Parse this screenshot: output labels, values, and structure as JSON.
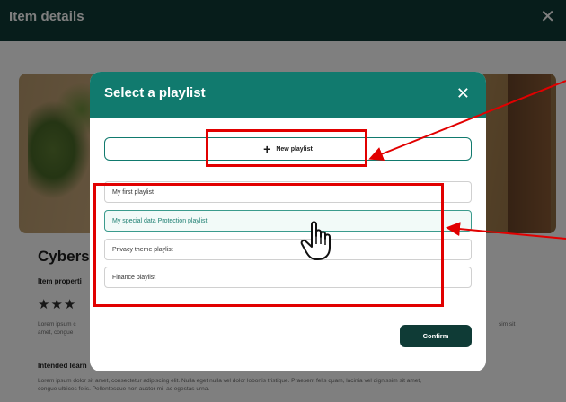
{
  "background": {
    "header_title": "Item details",
    "close_glyph": "✕",
    "heading": "Cybers",
    "properties_label": "Item properti",
    "stars": "★★★",
    "paragraph_left": [
      "Lorem ipsum c",
      "amet, congue"
    ],
    "paragraph_right": "sim sit",
    "intended_label": "Intended learn",
    "footer_text": [
      "Lorem ipsum dolor sit amet, consectetur adipiscing elit. Nulla eget nulla vel dolor lobortis tristique. Praesent felis quam, lacinia vel dignissim sit amet,",
      "congue ultrices felis. Pellentesque non auctor mi, ac egestas urna."
    ]
  },
  "modal": {
    "title": "Select a playlist",
    "close_glyph": "✕",
    "new_playlist_icon": "plus-icon",
    "new_playlist_label": "New playlist",
    "playlists": [
      {
        "label": "My first playlist",
        "selected": false
      },
      {
        "label": "My special data Protection playlist",
        "selected": true
      },
      {
        "label": "Privacy theme playlist",
        "selected": false
      },
      {
        "label": "Finance playlist",
        "selected": false
      }
    ],
    "confirm_label": "Confirm"
  },
  "colors": {
    "page_header": "#0f3b36",
    "modal_header": "#117a6e",
    "confirm_button": "#0f3b36",
    "annotation": "#e10000"
  }
}
